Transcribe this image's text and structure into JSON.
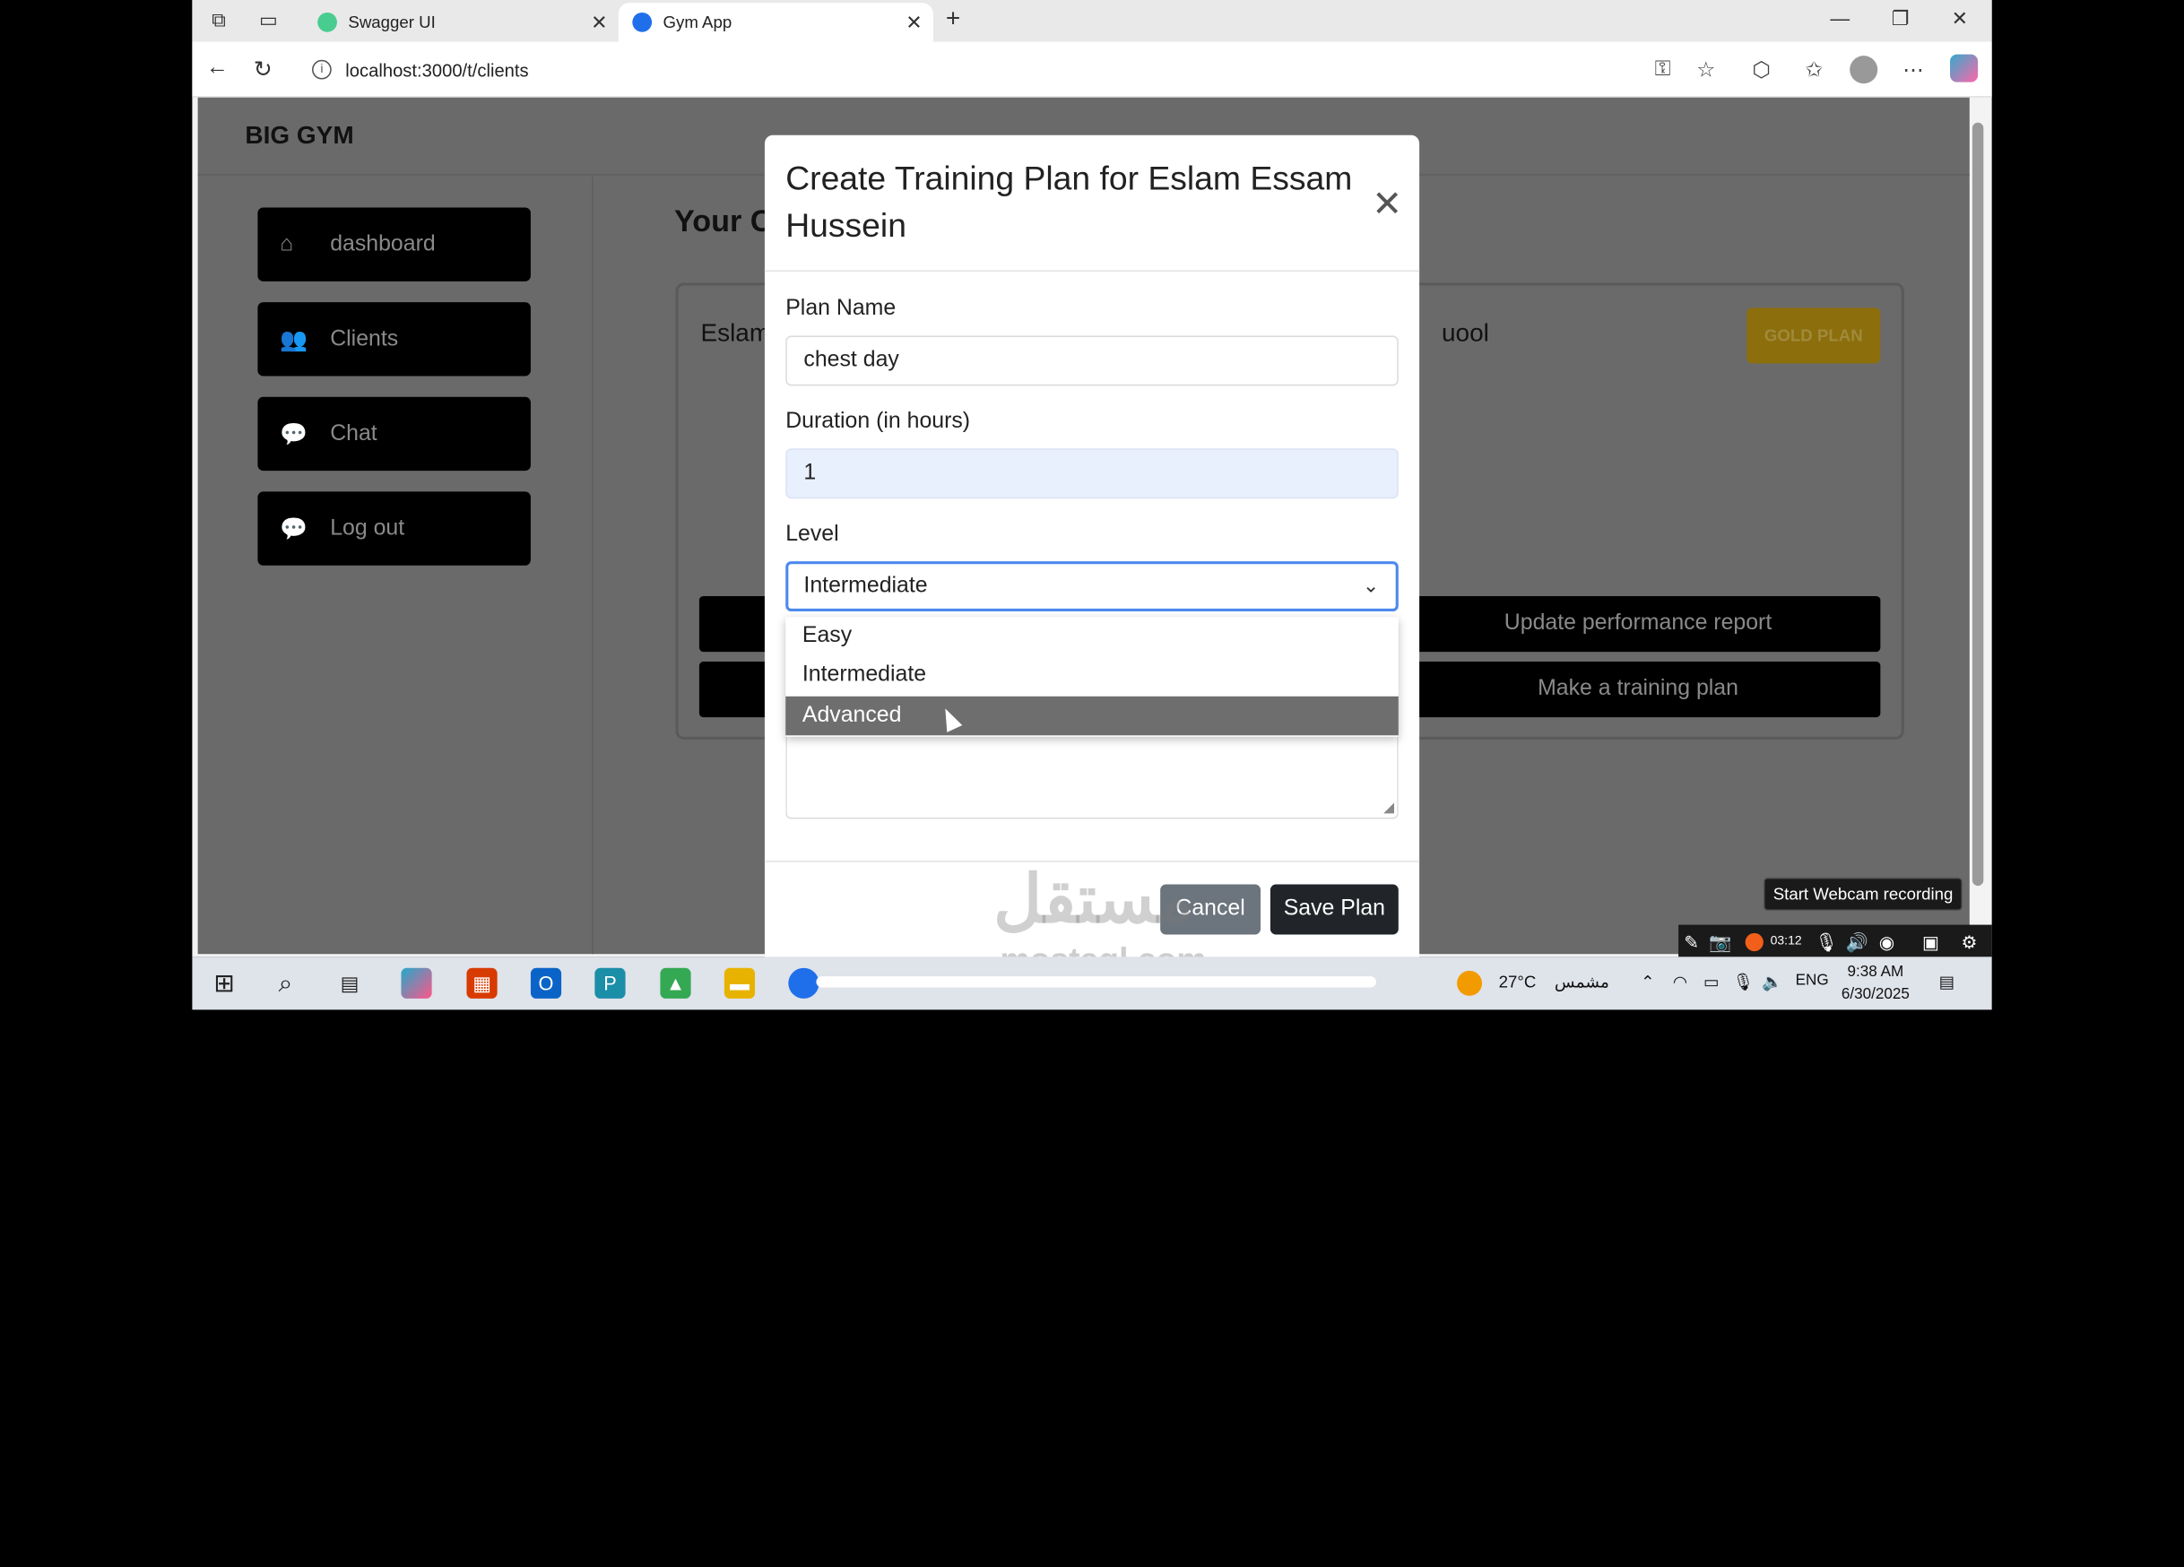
{
  "browser": {
    "tabs": [
      {
        "label": "Swagger UI",
        "favicon_color": "#49cc90"
      },
      {
        "label": "Gym App",
        "favicon_color": "#1f6feb"
      }
    ],
    "url": "localhost:3000/t/clients"
  },
  "app": {
    "brand": "BIG GYM",
    "sidebar": [
      {
        "label": "dashboard",
        "icon": "home-icon"
      },
      {
        "label": "Clients",
        "icon": "users-icon"
      },
      {
        "label": "Chat",
        "icon": "chat-icon"
      },
      {
        "label": "Log out",
        "icon": "chat-icon"
      }
    ],
    "heading_partial": "Your C",
    "card": {
      "name_left_partial": "Eslam",
      "name_right_partial": "uool",
      "badge": "GOLD PLAN",
      "buttons": [
        "Update performance report",
        "Make a training plan"
      ]
    }
  },
  "modal": {
    "title": "Create Training Plan for Eslam Essam Hussein",
    "plan_name_label": "Plan Name",
    "plan_name_value": "chest day",
    "duration_label": "Duration (in hours)",
    "duration_value": "1",
    "level_label": "Level",
    "level_value": "Intermediate",
    "level_options": [
      "Easy",
      "Intermediate",
      "Advanced"
    ],
    "highlighted_option": "Advanced",
    "cancel_label": "Cancel",
    "save_label": "Save Plan"
  },
  "watermark": {
    "text": "مستقل",
    "sub": "mostaql.com"
  },
  "recorder": {
    "tooltip": "Start Webcam recording",
    "timer": "03:12"
  },
  "taskbar": {
    "weather_temp": "27°C",
    "weather_desc": "مشمس",
    "lang": "ENG",
    "time": "9:38 AM",
    "date": "6/30/2025"
  }
}
